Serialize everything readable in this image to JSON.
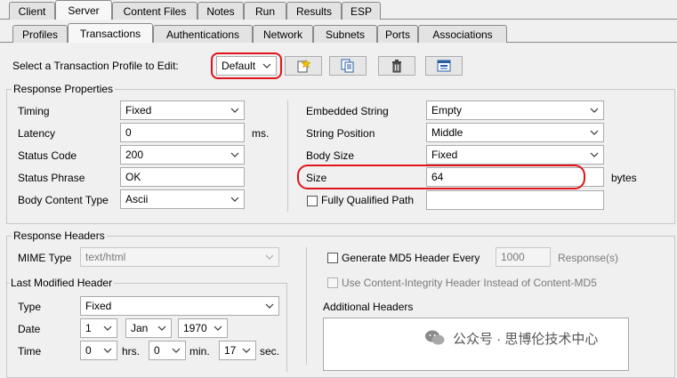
{
  "tabs_top": [
    "Client",
    "Server",
    "Content Files",
    "Notes",
    "Run",
    "Results",
    "ESP"
  ],
  "tabs_sub": [
    "Profiles",
    "Transactions",
    "Authentications",
    "Network",
    "Subnets",
    "Ports",
    "Associations"
  ],
  "profile_select": {
    "label": "Select a Transaction Profile to Edit:",
    "value": "Default"
  },
  "response_properties": {
    "title": "Response Properties",
    "timing": {
      "label": "Timing",
      "value": "Fixed"
    },
    "latency": {
      "label": "Latency",
      "value": "0",
      "unit": "ms."
    },
    "status_code": {
      "label": "Status Code",
      "value": "200"
    },
    "status_phrase": {
      "label": "Status Phrase",
      "value": "OK"
    },
    "body_content_type": {
      "label": "Body Content Type",
      "value": "Ascii"
    },
    "embedded_string": {
      "label": "Embedded String",
      "value": "Empty"
    },
    "string_position": {
      "label": "String Position",
      "value": "Middle"
    },
    "body_size": {
      "label": "Body Size",
      "value": "Fixed"
    },
    "size": {
      "label": "Size",
      "value": "64",
      "unit": "bytes"
    },
    "fully_qualified_path": {
      "label": "Fully Qualified Path",
      "value": ""
    }
  },
  "response_headers": {
    "title": "Response Headers",
    "mime_type": {
      "label": "MIME Type",
      "value": "text/html"
    },
    "last_modified_title": "Last Modified Header",
    "type": {
      "label": "Type",
      "value": "Fixed"
    },
    "date": {
      "label": "Date",
      "day": "1",
      "month": "Jan",
      "year": "1970"
    },
    "time": {
      "label": "Time",
      "hrs": "0",
      "hrs_unit": "hrs.",
      "min": "0",
      "min_unit": "min.",
      "sec": "17",
      "sec_unit": "sec."
    },
    "md5": {
      "label": "Generate MD5 Header Every",
      "value": "1000",
      "unit": "Response(s)"
    },
    "content_integrity": {
      "label": "Use Content-Integrity Header Instead of Content-MD5"
    },
    "additional_headers": {
      "label": "Additional Headers"
    }
  },
  "watermark": "公众号 · 思博伦技术中心",
  "colors": {
    "highlight": "#e0141a",
    "background": "#f0f0f0"
  }
}
